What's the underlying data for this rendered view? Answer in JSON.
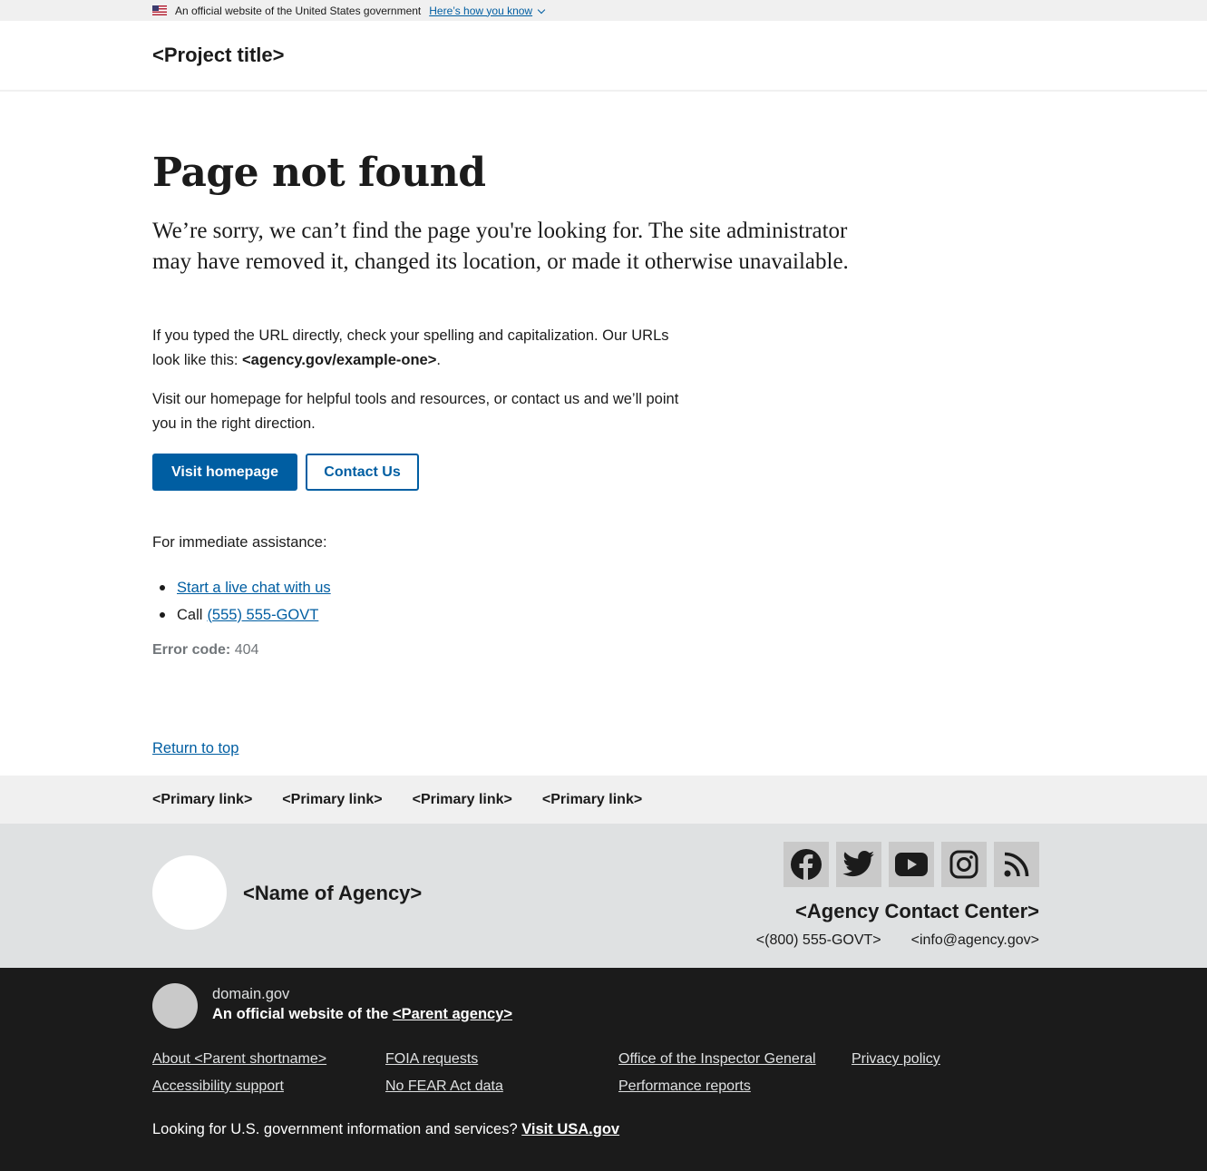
{
  "banner": {
    "text": "An official website of the United States government",
    "link": "Here’s how you know"
  },
  "header": {
    "title": "<Project title>"
  },
  "main": {
    "heading": "Page not found",
    "lede": "We’re sorry, we can’t find the page you're looking for. The site administrator may have removed it, changed its location, or made it otherwise unavailable.",
    "p1_text": "If you typed the URL directly, check your spelling and capitalization. Our URLs look like this: ",
    "p1_url": "<agency.gov/example-one>",
    "p1_end": ".",
    "p2": "Visit our homepage for helpful tools and resources, or contact us and we’ll point you in the right direction.",
    "visit_button": "Visit homepage",
    "contact_button": "Contact Us",
    "assist_intro": "For immediate assistance:",
    "chat_link": "Start a live chat with us",
    "call_label": "Call",
    "phone_link": "(555) 555-GOVT",
    "error_label": "Error code:",
    "error_value": "404"
  },
  "return_to_top": "Return to top",
  "footer": {
    "primary_links": [
      "<Primary link>",
      "<Primary link>",
      "<Primary link>",
      "<Primary link>"
    ],
    "agency_name": "<Name of Agency>",
    "social_icons": [
      "facebook-icon",
      "twitter-icon",
      "youtube-icon",
      "instagram-icon",
      "rss-icon"
    ],
    "contact_heading": "<Agency Contact Center>",
    "contact_phone": "<(800) 555-GOVT>",
    "contact_email": "<info@agency.gov>"
  },
  "identifier": {
    "domain": "domain.gov",
    "official_prefix": "An official website of the ",
    "parent_agency": "<Parent agency>",
    "links": [
      "About <Parent shortname>",
      "FOIA requests",
      "Office of the Inspector General",
      "Privacy policy",
      "Accessibility support",
      "No FEAR Act data",
      "Performance reports"
    ],
    "usa_prefix": "Looking for U.S. government information and services? ",
    "usa_link": "Visit USA.gov"
  },
  "colors": {
    "primary": "#005ea2",
    "text": "#1b1b1b",
    "banner_bg": "#f0f0f0",
    "footer_secondary_bg": "#dfe1e2",
    "identifier_bg": "#1b1b1b"
  }
}
